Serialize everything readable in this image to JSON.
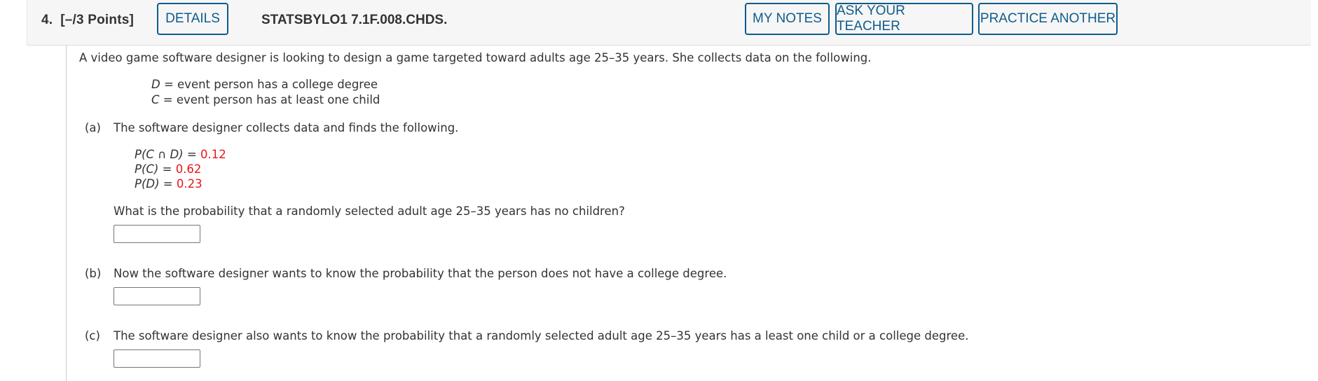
{
  "header": {
    "question_number": "4.",
    "points": "[–/3 Points]",
    "details_label": "DETAILS",
    "question_id": "STATSBYLO1 7.1F.008.CHDS.",
    "my_notes_label": "MY NOTES",
    "ask_teacher_label": "ASK YOUR TEACHER",
    "practice_another_label": "PRACTICE ANOTHER"
  },
  "question": {
    "intro": "A video game software designer is looking to design a game targeted toward adults age 25–35 years. She collects data on the following.",
    "definitions": [
      {
        "var": "D",
        "text": " = event person has a college degree"
      },
      {
        "var": "C",
        "text": " = event person has at least one child"
      }
    ],
    "parts": [
      {
        "label": "(a)",
        "text": "The software designer collects data and finds the following.",
        "given": [
          {
            "expr": "P(C ∩ D)",
            "eq": " = ",
            "value": "0.12"
          },
          {
            "expr": "P(C)",
            "eq": " = ",
            "value": "0.62"
          },
          {
            "expr": "P(D)",
            "eq": " = ",
            "value": "0.23"
          }
        ],
        "prompt": "What is the probability that a randomly selected adult age 25–35 years has no children?",
        "answer": ""
      },
      {
        "label": "(b)",
        "text": "Now the software designer wants to know the probability that the person does not have a college degree.",
        "answer": ""
      },
      {
        "label": "(c)",
        "text": "The software designer also wants to know the probability that a randomly selected adult age 25–35 years has a least one child or a college degree.",
        "answer": ""
      }
    ]
  },
  "colors": {
    "accent": "#0e5c8c",
    "given_value": "#e8161a",
    "header_bg": "#f6f6f6"
  }
}
